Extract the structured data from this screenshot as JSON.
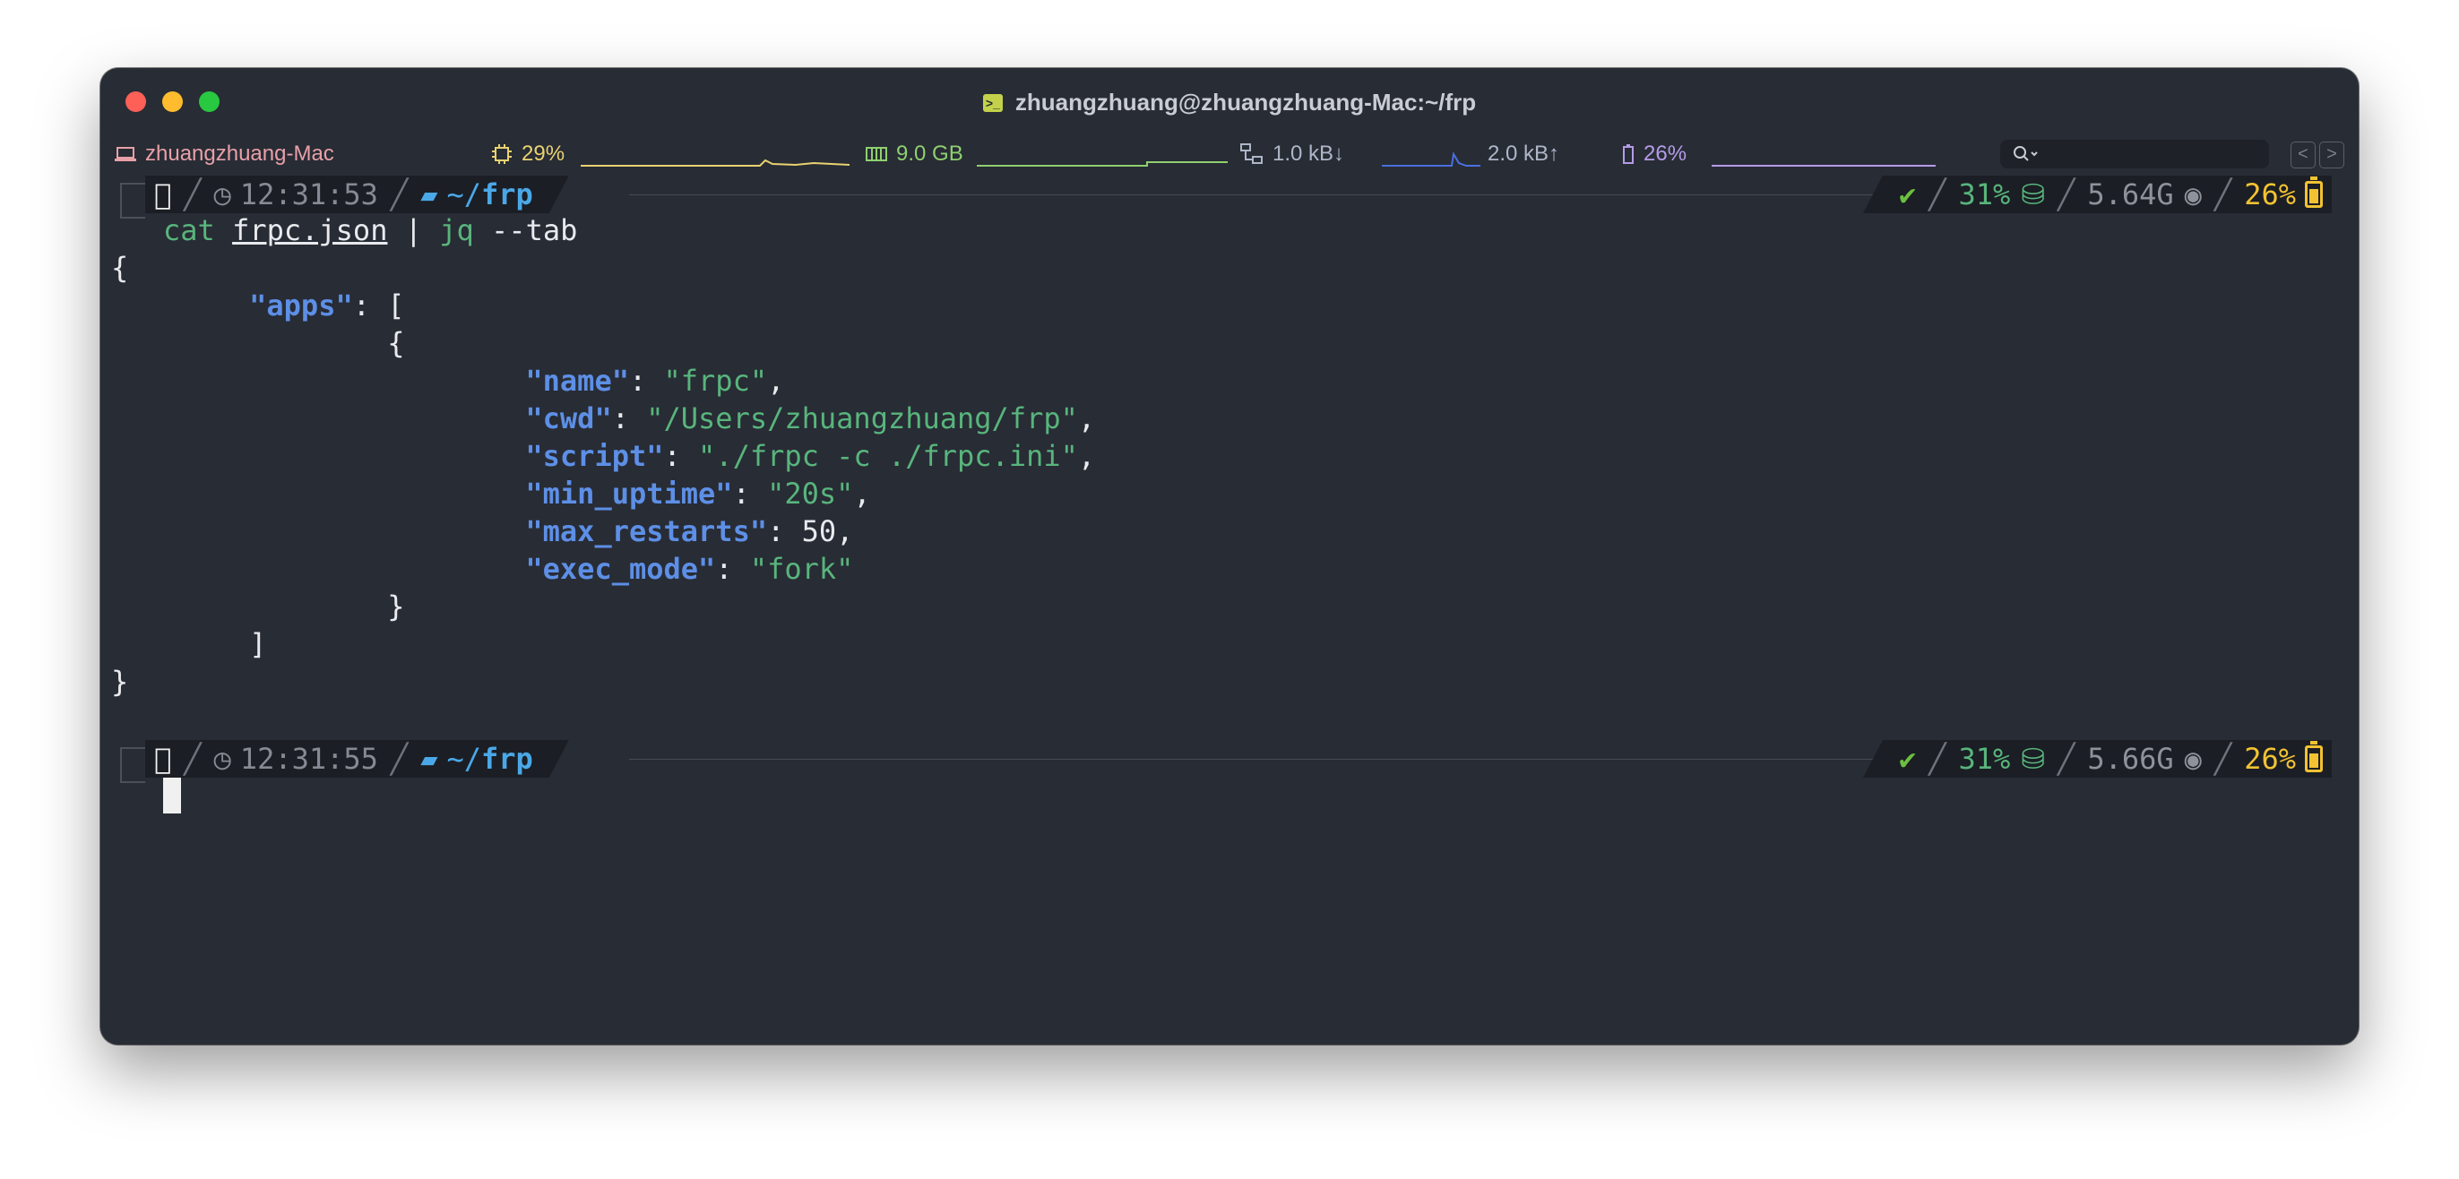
{
  "window": {
    "title": "zhuangzhuang@zhuangzhuang-Mac:~/frp"
  },
  "statusbar": {
    "hostname": "zhuangzhuang-Mac",
    "cpu": "29%",
    "memory": "9.0 GB",
    "net_down": "1.0 kB↓",
    "net_up": "2.0 kB↑",
    "battery": "26%",
    "nav_back": "<",
    "nav_forward": ">"
  },
  "prompt1": {
    "time": "12:31:53",
    "path_prefix": "~/",
    "path_dir": "frp",
    "status": "✔",
    "disk": "31%",
    "mem": "5.64G",
    "battery": "26%"
  },
  "command": {
    "cat": "cat",
    "file": "frpc.json",
    "pipe": "|",
    "jq": "jq",
    "args": "--tab"
  },
  "output": {
    "open_brace": "{",
    "apps_key": "\"apps\"",
    "apps_open": ": [",
    "obj_open": "{",
    "name_key": "\"name\"",
    "name_val": "\"frpc\"",
    "cwd_key": "\"cwd\"",
    "cwd_val": "\"/Users/zhuangzhuang/frp\"",
    "script_key": "\"script\"",
    "script_val": "\"./frpc -c ./frpc.ini\"",
    "min_uptime_key": "\"min_uptime\"",
    "min_uptime_val": "\"20s\"",
    "max_restarts_key": "\"max_restarts\"",
    "max_restarts_val": "50",
    "exec_mode_key": "\"exec_mode\"",
    "exec_mode_val": "\"fork\"",
    "obj_close": "}",
    "apps_close": "]",
    "close_brace": "}"
  },
  "prompt2": {
    "time": "12:31:55",
    "path_prefix": "~/",
    "path_dir": "frp",
    "status": "✔",
    "disk": "31%",
    "mem": "5.66G",
    "battery": "26%"
  },
  "colors": {
    "background": "#282c35",
    "json_key": "#5d8fe6",
    "json_string": "#58b57c",
    "path": "#4aa8e8",
    "battery": "#f2c232",
    "ok": "#6bc041"
  }
}
